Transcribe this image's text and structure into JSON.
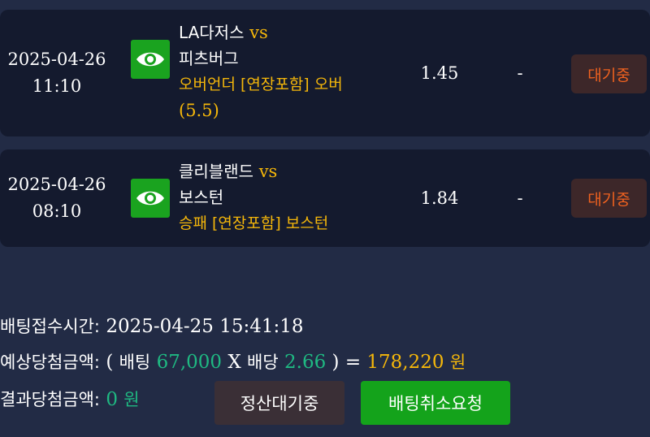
{
  "bets": [
    {
      "date": "2025-04-26",
      "time": "11:10",
      "home": "LA다저스",
      "vs": "vs",
      "away": "피츠버그",
      "pick_text": "오버언더 [연장포함] 오버",
      "pick_value": "(5.5)",
      "odds": "1.45",
      "result": "-",
      "status": "대기중"
    },
    {
      "date": "2025-04-26",
      "time": "08:10",
      "home": "클리블랜드",
      "vs": "vs",
      "away": "보스턴",
      "pick_text": "승패 [연장포함] 보스턴",
      "pick_value": "",
      "odds": "1.84",
      "result": "-",
      "status": "대기중"
    }
  ],
  "summary": {
    "time_label": "배팅접수시간:",
    "time_value": "2025-04-25 15:41:18",
    "expected_label": "예상당첨금액:",
    "open_paren": "(",
    "bet_word": "배팅",
    "bet_amount": "67,000",
    "x_sign": "X",
    "odds_word": "배당",
    "total_odds": "2.66",
    "close_eq": ") =",
    "expected_amount": "178,220",
    "won": "원",
    "result_label": "결과당첨금액:",
    "result_amount": "0",
    "result_won": "원"
  },
  "buttons": {
    "settle_label": "정산대기중",
    "cancel_label": "배팅취소요청"
  },
  "colors": {
    "accent_yellow": "#f5b70a",
    "accent_green": "#1fb982",
    "status_orange": "#f0621f",
    "button_green": "#14a31b"
  },
  "icons": {
    "view": "eye-icon"
  }
}
